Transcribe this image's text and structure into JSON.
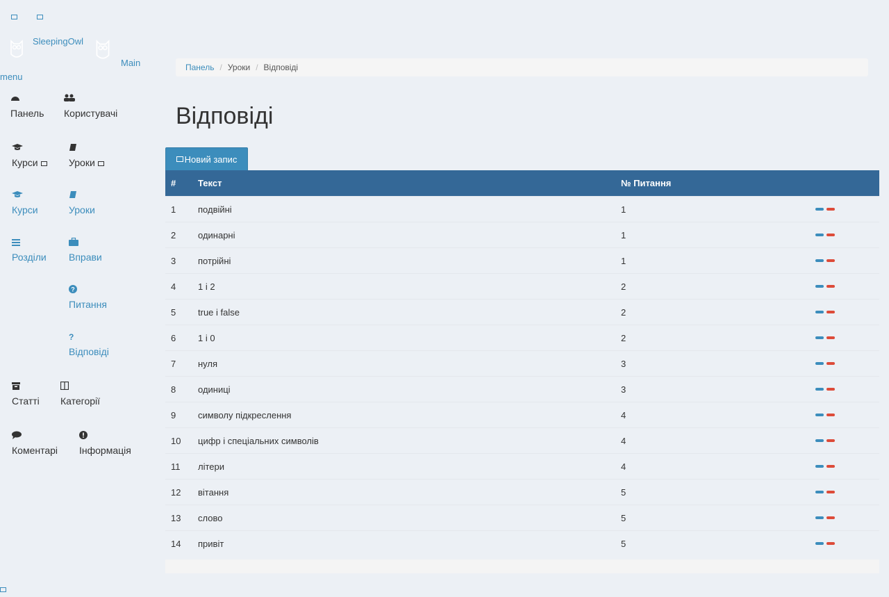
{
  "brand": {
    "name": "SleepingOwl",
    "menu_word_1": "Main",
    "menu_word_2": "menu"
  },
  "sidebar": {
    "items": [
      {
        "label": "Панель",
        "icon": "dashboard-icon"
      },
      {
        "label": "Користувачі",
        "icon": "users-icon"
      },
      {
        "label": "Курси",
        "icon": "graduation-cap-icon"
      },
      {
        "label": "Уроки",
        "icon": "book-icon"
      },
      {
        "label": "Курси",
        "icon": "graduation-cap-icon"
      },
      {
        "label": "Уроки",
        "icon": "book-icon"
      },
      {
        "label": "Розділи",
        "icon": "list-icon"
      },
      {
        "label": "Вправи",
        "icon": "briefcase-icon"
      },
      {
        "label": "Питання",
        "icon": "question-circle-icon"
      },
      {
        "label": "?",
        "icon": "question-icon"
      },
      {
        "label": "Відповіді",
        "icon": "question-icon"
      },
      {
        "label": "Статті",
        "icon": "archive-icon"
      },
      {
        "label": "Категорії",
        "icon": "columns-icon"
      },
      {
        "label": "Коментарі",
        "icon": "comment-icon"
      },
      {
        "label": "Інформація",
        "icon": "exclamation-circle-icon"
      }
    ]
  },
  "breadcrumb": {
    "home": "Панель",
    "parent": "Уроки",
    "current": "Відповіді"
  },
  "page": {
    "title": "Відповіді",
    "new_button": "Новий запис"
  },
  "table": {
    "headers": {
      "index": "#",
      "text": "Текст",
      "question": "№ Питання"
    },
    "rows": [
      {
        "id": "1",
        "text": "подвійні",
        "question": "1"
      },
      {
        "id": "2",
        "text": "одинарні",
        "question": "1"
      },
      {
        "id": "3",
        "text": "потрійні",
        "question": "1"
      },
      {
        "id": "4",
        "text": "1 і 2",
        "question": "2"
      },
      {
        "id": "5",
        "text": "true і false",
        "question": "2"
      },
      {
        "id": "6",
        "text": "1 і 0",
        "question": "2"
      },
      {
        "id": "7",
        "text": "нуля",
        "question": "3"
      },
      {
        "id": "8",
        "text": "одиниці",
        "question": "3"
      },
      {
        "id": "9",
        "text": "символу підкреслення",
        "question": "4"
      },
      {
        "id": "10",
        "text": "цифр і спеціальних символів",
        "question": "4"
      },
      {
        "id": "11",
        "text": "літери",
        "question": "4"
      },
      {
        "id": "12",
        "text": "вітання",
        "question": "5"
      },
      {
        "id": "13",
        "text": "слово",
        "question": "5"
      },
      {
        "id": "14",
        "text": "привіт",
        "question": "5"
      }
    ]
  },
  "colors": {
    "accent": "#3c8dbc",
    "header_bg": "#346897",
    "delete": "#dd4b39",
    "page_bg": "#ecf0f5"
  }
}
